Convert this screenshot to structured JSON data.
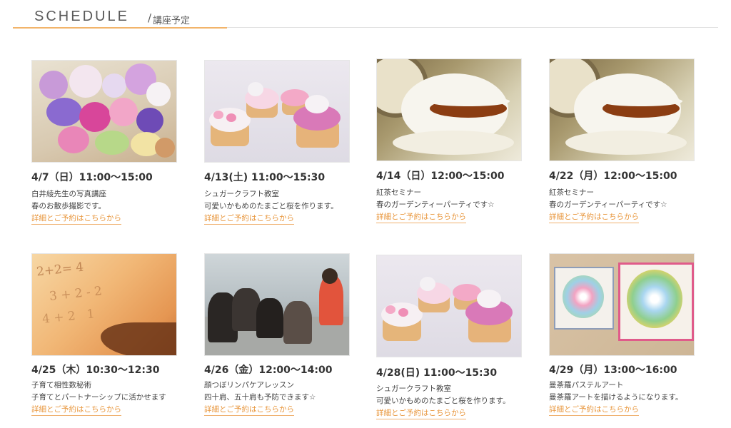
{
  "header": {
    "title": "SCHEDULE",
    "subtitle": "講座予定",
    "slash": "/"
  },
  "link_label": "詳細とご予約はこちらから",
  "cards": [
    {
      "date": "4/7（日）11:00〜15:00",
      "line1": "白井綾先生の写真講座",
      "line2": "春のお散歩撮影です。",
      "link": "詳細とご予約はこちらから",
      "photo": "flower-bouquet"
    },
    {
      "date": "4/13(土) 11:00〜15:30",
      "line1": "シュガークラフト教室",
      "line2": "可愛いかもめのたまごと桜を作ります。",
      "link": "詳細とご予約はこちらから",
      "photo": "cupcakes"
    },
    {
      "date": "4/14（日）12:00〜15:00",
      "line1": "紅茶セミナー",
      "line2": "春のガーデンティーパーティです☆",
      "link": "詳細とご予約はこちらから",
      "photo": "teacup"
    },
    {
      "date": "4/22（月）12:00〜15:00",
      "line1": "紅茶セミナー",
      "line2": "春のガーデンティーパーティです☆",
      "link": "詳細とご予約はこちらから",
      "photo": "teacup"
    },
    {
      "date": "4/25（木）10:30〜12:30",
      "line1": "子育て相性数秘術",
      "line2": "子育てとパートナーシップに活かせます",
      "link": "詳細とご予約はこちらから",
      "photo": "handwritten-numbers"
    },
    {
      "date": "4/26（金）12:00〜14:00",
      "line1": "顔つぼリンパケアレッスン",
      "line2": "四十肩、五十肩も予防できます☆",
      "link": "詳細とご予約はこちらから",
      "photo": "class"
    },
    {
      "date": "4/28(日) 11:00〜15:30",
      "line1": "シュガークラフト教室",
      "line2": "可愛いかもめのたまごと桜を作ります。",
      "link": "詳細とご予約はこちらから",
      "photo": "cupcakes"
    },
    {
      "date": "4/29（月）13:00〜16:00",
      "line1": "曼荼羅パステルアート",
      "line2": "曼荼羅アートを描けるようになります。",
      "link": "詳細とご予約はこちらから",
      "photo": "pastel-mandala"
    }
  ],
  "colors": {
    "accent": "#e8963c",
    "rule": "#f2b46a",
    "text": "#3a3a3a"
  }
}
